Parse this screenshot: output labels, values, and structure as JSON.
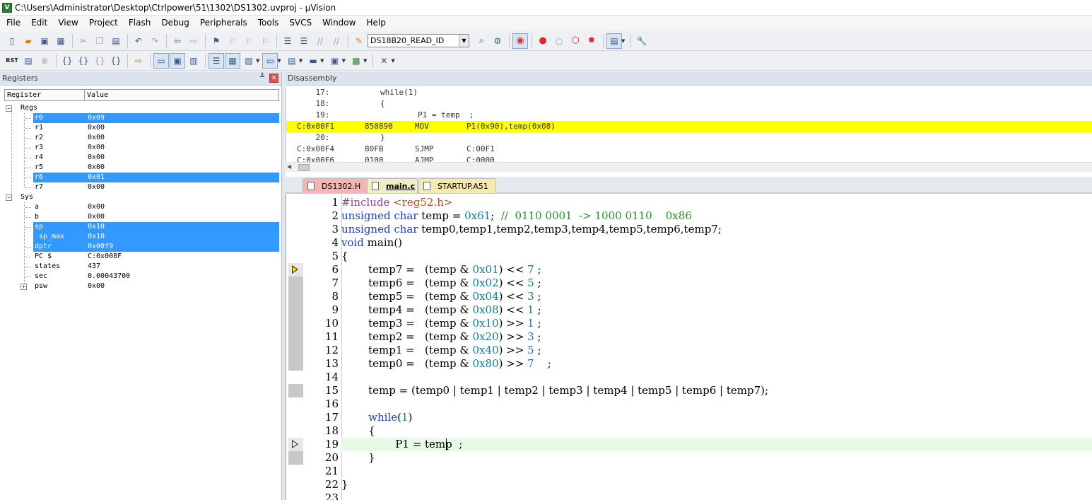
{
  "window": {
    "title": "C:\\Users\\Administrator\\Desktop\\Ctrlpower\\51\\1302\\DS1302.uvproj - µVision",
    "icon_text": "V"
  },
  "menu": [
    "File",
    "Edit",
    "View",
    "Project",
    "Flash",
    "Debug",
    "Peripherals",
    "Tools",
    "SVCS",
    "Window",
    "Help"
  ],
  "toolbar1": {
    "target": "DS18B20_READ_ID"
  },
  "toolbar2": {
    "reset_label": "RST"
  },
  "registers_panel": {
    "title": "Registers",
    "columns": [
      "Register",
      "Value"
    ],
    "groups": {
      "regs": "Regs",
      "sys": "Sys"
    },
    "rows": [
      {
        "name": "r0",
        "value": "0x09"
      },
      {
        "name": "r1",
        "value": "0x00"
      },
      {
        "name": "r2",
        "value": "0x00"
      },
      {
        "name": "r3",
        "value": "0x00"
      },
      {
        "name": "r4",
        "value": "0x00"
      },
      {
        "name": "r5",
        "value": "0x00"
      },
      {
        "name": "r6",
        "value": "0x01"
      },
      {
        "name": "r7",
        "value": "0x00"
      },
      {
        "name": "a",
        "value": "0x00"
      },
      {
        "name": "b",
        "value": "0x00"
      },
      {
        "name": "sp",
        "value": "0x10"
      },
      {
        "name": "sp_max",
        "value": "0x10"
      },
      {
        "name": "dptr",
        "value": "0x00f9"
      },
      {
        "name": "PC  $",
        "value": "C:0x008F"
      },
      {
        "name": "states",
        "value": "437"
      },
      {
        "name": "sec",
        "value": "0.00043700"
      },
      {
        "name": "psw",
        "value": "0x00"
      }
    ]
  },
  "disassembly": {
    "title": "Disassembly",
    "lines": [
      {
        "a": "    17:",
        "b": "        while(1)"
      },
      {
        "a": "    18:",
        "b": "        {"
      },
      {
        "a": "    19:",
        "b": "                P1 = temp  ;"
      },
      {
        "a": "C:0x00F1",
        "b": "850890",
        "c": "MOV",
        "d": "P1(0x90),temp(0x08)"
      },
      {
        "a": "    20:",
        "b": "        }"
      },
      {
        "a": "C:0x00F4",
        "b": "80FB",
        "c": "SJMP",
        "d": "C:00F1"
      },
      {
        "a": "C:0x00F6",
        "b": "0100",
        "c": "AJMP",
        "d": "C:0000"
      }
    ]
  },
  "tabs": [
    "DS1302.H",
    "main.c",
    "STARTUP.A51"
  ],
  "editor": {
    "lines": [
      {
        "n": "1",
        "t": [
          [
            "pp",
            "#include "
          ],
          [
            "ppinc",
            "<reg52.h>"
          ]
        ]
      },
      {
        "n": "2",
        "t": [
          [
            "kw",
            "unsigned char"
          ],
          [
            "",
            " temp = "
          ],
          [
            "num",
            "0x61"
          ],
          [
            "",
            ";  "
          ],
          [
            "cmt",
            "//  0110 0001  -> 1000 0110    0x86"
          ]
        ]
      },
      {
        "n": "3",
        "t": [
          [
            "kw",
            "unsigned char"
          ],
          [
            "",
            " temp0,temp1,temp2,temp3,temp4,temp5,temp6,temp7;"
          ]
        ]
      },
      {
        "n": "4",
        "t": [
          [
            "kw",
            "void"
          ],
          [
            "",
            " main()"
          ]
        ]
      },
      {
        "n": "5",
        "t": [
          [
            "",
            "{"
          ]
        ]
      },
      {
        "n": "6",
        "t": [
          [
            "",
            "        temp7 =   (temp & "
          ],
          [
            "num",
            "0x01"
          ],
          [
            "",
            ") << "
          ],
          [
            "num",
            "7"
          ],
          [
            "",
            " ;"
          ]
        ]
      },
      {
        "n": "7",
        "t": [
          [
            "",
            "        temp6 =   (temp & "
          ],
          [
            "num",
            "0x02"
          ],
          [
            "",
            ") << "
          ],
          [
            "num",
            "5"
          ],
          [
            "",
            " ;"
          ]
        ]
      },
      {
        "n": "8",
        "t": [
          [
            "",
            "        temp5 =   (temp & "
          ],
          [
            "num",
            "0x04"
          ],
          [
            "",
            ") << "
          ],
          [
            "num",
            "3"
          ],
          [
            "",
            " ;"
          ]
        ]
      },
      {
        "n": "9",
        "t": [
          [
            "",
            "        temp4 =   (temp & "
          ],
          [
            "num",
            "0x08"
          ],
          [
            "",
            ") << "
          ],
          [
            "num",
            "1"
          ],
          [
            "",
            " ;"
          ]
        ]
      },
      {
        "n": "10",
        "t": [
          [
            "",
            "        temp3 =   (temp & "
          ],
          [
            "num",
            "0x10"
          ],
          [
            "",
            ") >> "
          ],
          [
            "num",
            "1"
          ],
          [
            "",
            " ;"
          ]
        ]
      },
      {
        "n": "11",
        "t": [
          [
            "",
            "        temp2 =   (temp & "
          ],
          [
            "num",
            "0x20"
          ],
          [
            "",
            ") >> "
          ],
          [
            "num",
            "3"
          ],
          [
            "",
            " ;"
          ]
        ]
      },
      {
        "n": "12",
        "t": [
          [
            "",
            "        temp1 =   (temp & "
          ],
          [
            "num",
            "0x40"
          ],
          [
            "",
            ") >> "
          ],
          [
            "num",
            "5"
          ],
          [
            "",
            " ;"
          ]
        ]
      },
      {
        "n": "13",
        "t": [
          [
            "",
            "        temp0 =   (temp & "
          ],
          [
            "num",
            "0x80"
          ],
          [
            "",
            ") >> "
          ],
          [
            "num",
            "7"
          ],
          [
            "",
            "    ;"
          ]
        ]
      },
      {
        "n": "14",
        "t": []
      },
      {
        "n": "15",
        "t": [
          [
            "",
            "        temp = (temp0 | temp1 | temp2 | temp3 | temp4 | temp5 | temp6 | temp7);"
          ]
        ]
      },
      {
        "n": "16",
        "t": []
      },
      {
        "n": "17",
        "t": [
          [
            "",
            "        "
          ],
          [
            "kw",
            "while"
          ],
          [
            "",
            "("
          ],
          [
            "num",
            "1"
          ],
          [
            "",
            ")"
          ]
        ]
      },
      {
        "n": "18",
        "t": [
          [
            "",
            "        {"
          ]
        ]
      },
      {
        "n": "19",
        "t": [
          [
            "",
            "                P1 = temp  ;"
          ]
        ]
      },
      {
        "n": "20",
        "t": [
          [
            "",
            "        }"
          ]
        ]
      },
      {
        "n": "21",
        "t": []
      },
      {
        "n": "22",
        "t": [
          [
            "",
            "}"
          ]
        ]
      },
      {
        "n": "23",
        "t": []
      }
    ]
  }
}
